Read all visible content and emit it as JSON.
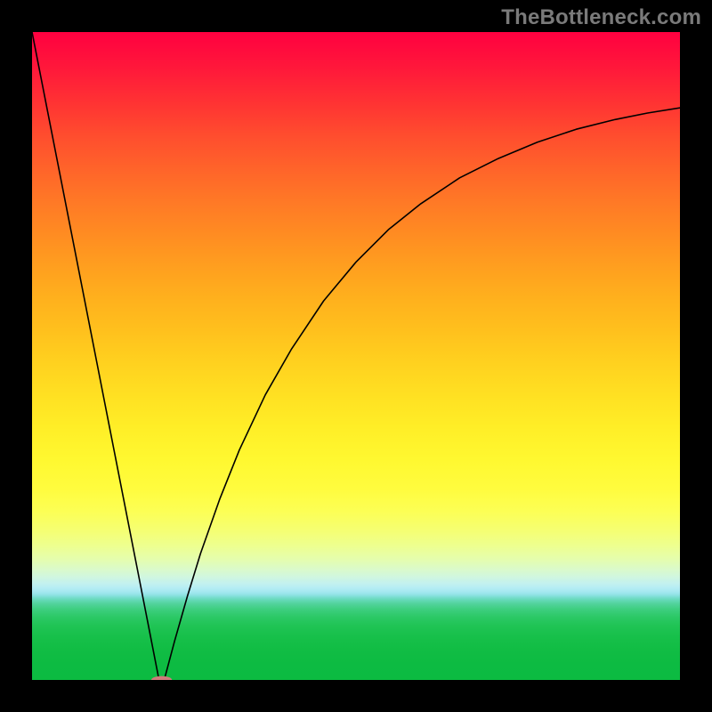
{
  "watermark": "TheBottleneck.com",
  "chart_data": {
    "type": "line",
    "title": "",
    "xlabel": "",
    "ylabel": "",
    "xlim": [
      0,
      100
    ],
    "ylim": [
      0,
      100
    ],
    "grid": false,
    "series": [
      {
        "name": "bottleneck-curve",
        "x": [
          0,
          2,
          4,
          6,
          8,
          10,
          12,
          14,
          16,
          18,
          19.6,
          20.4,
          22,
          24,
          26,
          29,
          32,
          36,
          40,
          45,
          50,
          55,
          60,
          66,
          72,
          78,
          84,
          90,
          95,
          100
        ],
        "y": [
          100,
          89.8,
          79.6,
          69.4,
          59.2,
          49.0,
          38.8,
          28.6,
          18.4,
          8.2,
          0,
          0,
          6.0,
          13.0,
          19.5,
          28.0,
          35.5,
          44.0,
          51.0,
          58.5,
          64.5,
          69.5,
          73.5,
          77.5,
          80.5,
          83.0,
          85.0,
          86.5,
          87.5,
          88.3
        ]
      }
    ],
    "marker": {
      "name": "optimal-point",
      "x": 20.0,
      "y": 0,
      "color": "#cf7b7b",
      "radius": 0.9
    },
    "gradient_stops": [
      {
        "pos": 0,
        "color": "#ff0040"
      },
      {
        "pos": 11,
        "color": "#ff3333"
      },
      {
        "pos": 26,
        "color": "#ff7826"
      },
      {
        "pos": 41,
        "color": "#ffb01d"
      },
      {
        "pos": 56,
        "color": "#ffe022"
      },
      {
        "pos": 70.5,
        "color": "#fffc3e"
      },
      {
        "pos": 81.5,
        "color": "#e4fdb0"
      },
      {
        "pos": 87,
        "color": "#76ddcc"
      },
      {
        "pos": 93.3,
        "color": "#17c04a"
      },
      {
        "pos": 100,
        "color": "#0cbb41"
      }
    ]
  }
}
